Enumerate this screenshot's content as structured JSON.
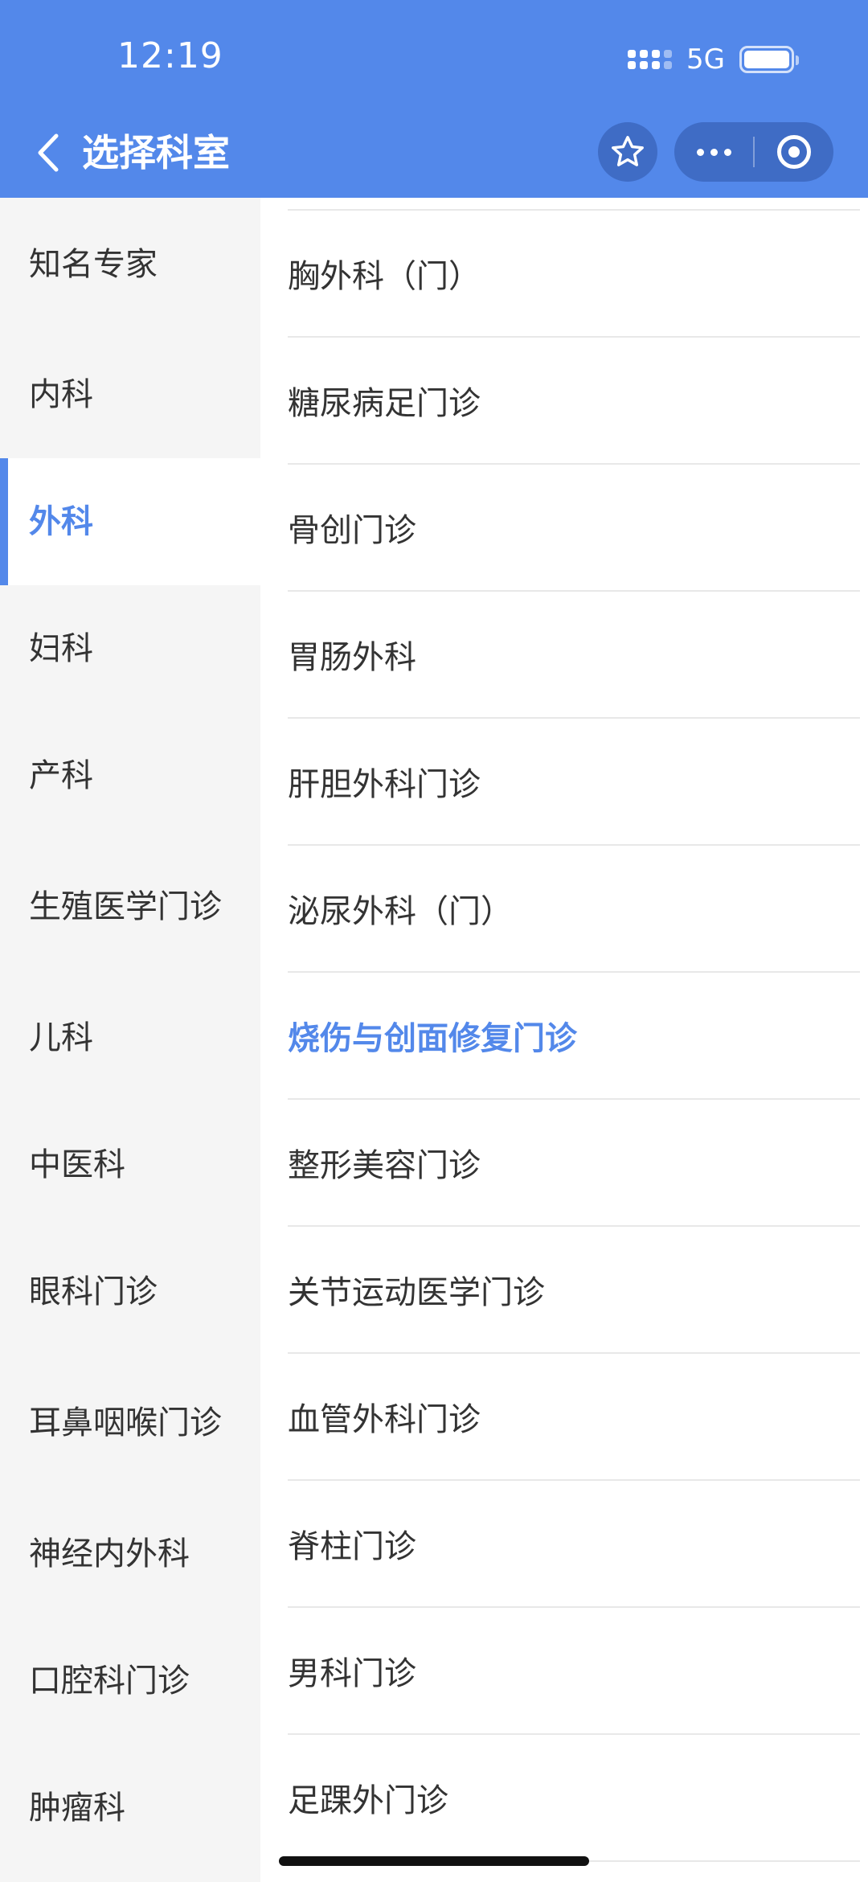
{
  "status_bar": {
    "time": "12:19",
    "network": "5G"
  },
  "header": {
    "title": "选择科室",
    "accent_color": "#5388EA"
  },
  "sidebar": {
    "items": [
      {
        "label": "知名专家"
      },
      {
        "label": "内科"
      },
      {
        "label": "外科",
        "active": true
      },
      {
        "label": "妇科"
      },
      {
        "label": "产科"
      },
      {
        "label": "生殖医学门诊"
      },
      {
        "label": "儿科"
      },
      {
        "label": "中医科"
      },
      {
        "label": "眼科门诊"
      },
      {
        "label": "耳鼻咽喉门诊"
      },
      {
        "label": "神经内外科"
      },
      {
        "label": "口腔科门诊"
      },
      {
        "label": "肿瘤科"
      }
    ]
  },
  "departments": {
    "items": [
      {
        "label": "胸外科（门）"
      },
      {
        "label": "糖尿病足门诊"
      },
      {
        "label": "骨创门诊"
      },
      {
        "label": "胃肠外科"
      },
      {
        "label": "肝胆外科门诊"
      },
      {
        "label": "泌尿外科（门）"
      },
      {
        "label": "烧伤与创面修复门诊",
        "highlighted": true
      },
      {
        "label": "整形美容门诊"
      },
      {
        "label": "关节运动医学门诊"
      },
      {
        "label": "血管外科门诊"
      },
      {
        "label": "脊柱门诊"
      },
      {
        "label": "男科门诊"
      },
      {
        "label": "足踝外门诊"
      }
    ]
  }
}
